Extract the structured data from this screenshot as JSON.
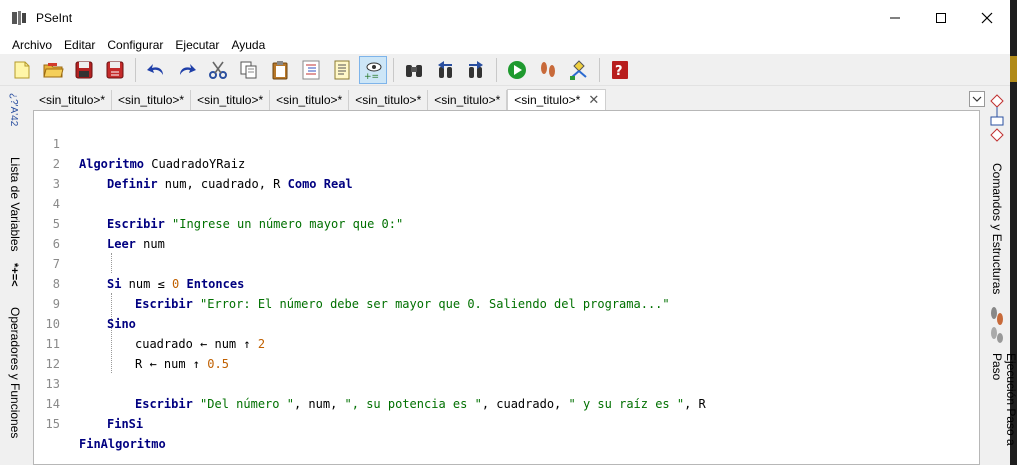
{
  "window": {
    "title": "PSeInt"
  },
  "menu": [
    "Archivo",
    "Editar",
    "Configurar",
    "Ejecutar",
    "Ayuda"
  ],
  "toolbar": {
    "buttons": [
      "new-file",
      "open-file",
      "save",
      "save-as",
      "undo",
      "redo",
      "cut",
      "copy",
      "paste",
      "format",
      "list",
      "debug-inspect",
      "find",
      "find-previous",
      "find-next",
      "run",
      "step-by-step",
      "flowchart",
      "help"
    ]
  },
  "left_panel": {
    "variables_label": "Lista de Variables",
    "variables_glyphs": "*+=<",
    "operators_label": "Operadores y Funciones",
    "operators_glyphs": "¿?'A'42"
  },
  "right_panel": {
    "commands_label": "Comandos y Estructuras",
    "stepper_label": "Ejecución Paso a Paso"
  },
  "tabs": [
    {
      "label": "<sin_titulo>*",
      "active": false
    },
    {
      "label": "<sin_titulo>*",
      "active": false
    },
    {
      "label": "<sin_titulo>*",
      "active": false
    },
    {
      "label": "<sin_titulo>*",
      "active": false
    },
    {
      "label": "<sin_titulo>*",
      "active": false
    },
    {
      "label": "<sin_titulo>*",
      "active": false
    },
    {
      "label": "<sin_titulo>*",
      "active": true
    }
  ],
  "code": {
    "line_numbers": [
      "1",
      "2",
      "3",
      "4",
      "5",
      "6",
      "7",
      "8",
      "9",
      "10",
      "11",
      "12",
      "13",
      "14",
      "15"
    ],
    "l1_kw": "Algoritmo",
    "l1_name": " CuadradoYRaiz",
    "l2_kw": "Definir",
    "l2_vars": " num, cuadrado, R ",
    "l2_kw2": "Como Real",
    "l4_kw": "Escribir",
    "l4_str": " \"Ingrese un número mayor que 0:\"",
    "l5_kw": "Leer",
    "l5_var": " num",
    "l7_kw": "Si",
    "l7_cond": " num ≤ ",
    "l7_num": "0",
    "l7_kw2": " Entonces",
    "l8_kw": "Escribir",
    "l8_str": " \"Error: El número debe ser mayor que 0. Saliendo del programa...\"",
    "l9_kw": "Sino",
    "l10_a": "cuadrado ← num ↑ ",
    "l10_num": "2",
    "l11_a": "R ← num ↑ ",
    "l11_num": "0.5",
    "l13_kw": "Escribir",
    "l13_s1": " \"Del número \"",
    "l13_t1": ", num, ",
    "l13_s2": "\", su potencia es \"",
    "l13_t2": ", cuadrado, ",
    "l13_s3": "\" y su raíz es \"",
    "l13_t3": ", R",
    "l14_kw": "FinSi",
    "l15_kw": "FinAlgoritmo"
  }
}
